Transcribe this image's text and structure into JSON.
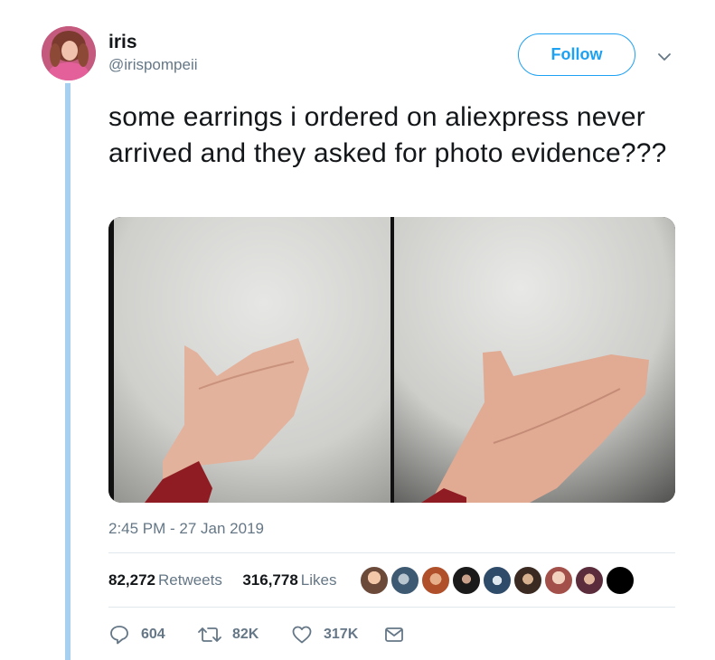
{
  "user": {
    "display_name": "iris",
    "handle": "@irispompeii"
  },
  "follow_label": "Follow",
  "tweet": {
    "text": "some earrings i ordered on aliexpress never arrived and they asked for photo evidence???",
    "timestamp": "2:45 PM - 27 Jan 2019"
  },
  "stats": {
    "retweets_count": "82,272",
    "retweets_label": "Retweets",
    "likes_count": "316,778",
    "likes_label": "Likes"
  },
  "actions": {
    "reply_count": "604",
    "retweet_count": "82K",
    "like_count": "317K"
  },
  "icons": {
    "caret": "chevron-down-icon",
    "reply": "reply-icon",
    "retweet": "retweet-icon",
    "like": "heart-icon",
    "message": "envelope-icon"
  },
  "colors": {
    "accent": "#1da1f2",
    "secondary_text": "#657786",
    "thread_line": "#a7d0f0"
  }
}
